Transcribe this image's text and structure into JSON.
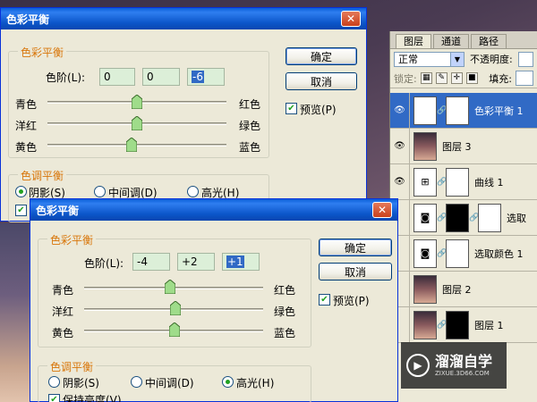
{
  "layers_panel": {
    "tabs": [
      "图层",
      "通道",
      "路径"
    ],
    "blend_mode": "正常",
    "opacity_label": "不透明度:",
    "lock_label": "锁定:",
    "fill_label": "填充:",
    "layers": [
      {
        "name": "色彩平衡 1",
        "kind": "adjustment",
        "selected": true
      },
      {
        "name": "图层 3",
        "kind": "photo",
        "selected": false
      },
      {
        "name": "曲线 1",
        "kind": "curves",
        "selected": false
      },
      {
        "name": "选取",
        "kind": "selective-masked",
        "selected": false
      },
      {
        "name": "选取颜色 1",
        "kind": "selective",
        "selected": false
      },
      {
        "name": "图层 2",
        "kind": "photo",
        "selected": false
      },
      {
        "name": "图层 1",
        "kind": "photo-masked",
        "selected": false
      }
    ]
  },
  "dialog_back": {
    "title": "色彩平衡",
    "group_color": "色彩平衡",
    "levels_label": "色阶(L):",
    "levels": [
      "0",
      "0",
      "-6"
    ],
    "slider_left": [
      "青色",
      "洋红",
      "黄色"
    ],
    "slider_right": [
      "红色",
      "绿色",
      "蓝色"
    ],
    "slider_values": [
      0,
      0,
      -6
    ],
    "ok": "确定",
    "cancel": "取消",
    "preview": "预览(P)",
    "group_tone": "色调平衡",
    "tone_options": [
      "阴影(S)",
      "中间调(D)",
      "高光(H)"
    ],
    "tone_selected": 0
  },
  "dialog_front": {
    "title": "色彩平衡",
    "group_color": "色彩平衡",
    "levels_label": "色阶(L):",
    "levels": [
      "-4",
      "+2",
      "+1"
    ],
    "slider_left": [
      "青色",
      "洋红",
      "黄色"
    ],
    "slider_right": [
      "红色",
      "绿色",
      "蓝色"
    ],
    "slider_values": [
      -4,
      2,
      1
    ],
    "ok": "确定",
    "cancel": "取消",
    "preview": "预览(P)",
    "group_tone": "色调平衡",
    "tone_options": [
      "阴影(S)",
      "中间调(D)",
      "高光(H)"
    ],
    "tone_selected": 2,
    "preserve": "保持亮度(V)"
  },
  "watermark": {
    "text": "溜溜自学",
    "sub": "ZIXUE.3D66.COM"
  }
}
